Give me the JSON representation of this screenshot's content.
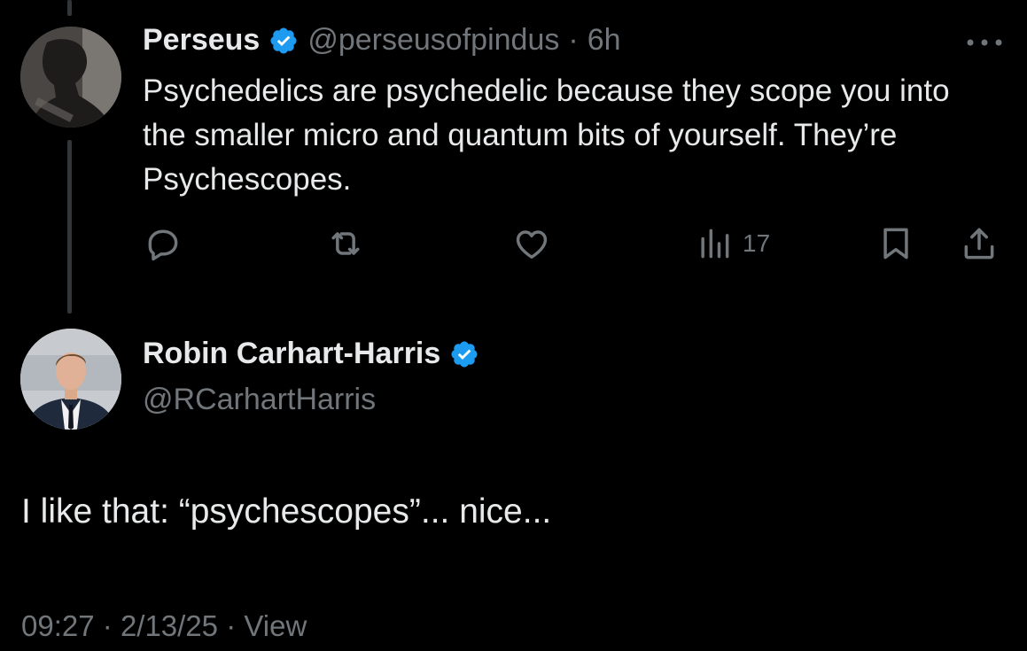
{
  "original_tweet": {
    "author_name": "Perseus",
    "handle": "@perseusofpindus",
    "separator": "·",
    "time": "6h",
    "text": "Psychedelics are psychedelic because they scope you into the smaller micro and quantum bits of yourself. They’re Psychescopes.",
    "views": "17",
    "icons": {
      "avatar": "avatar",
      "verified": "verified-badge-icon",
      "more": "more-icon",
      "reply": "reply-icon",
      "retweet": "retweet-icon",
      "like": "like-icon",
      "views": "views-icon",
      "bookmark": "bookmark-icon",
      "share": "share-icon"
    }
  },
  "reply_tweet": {
    "author_name": "Robin Carhart-Harris",
    "handle": "@RCarhartHarris",
    "text": "I like that: “psychescopes”... nice...",
    "time": "09:27",
    "date": "2/13/25",
    "view_label": "View",
    "separator": "·"
  },
  "colors": {
    "background": "#000000",
    "text_primary": "#e7e9ea",
    "text_secondary": "#71767b",
    "verified_blue": "#1d9bf0",
    "thread_line": "#333639"
  }
}
